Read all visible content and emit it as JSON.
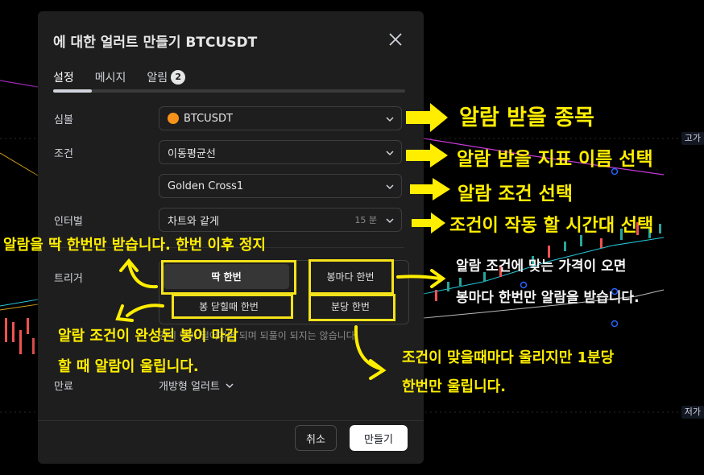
{
  "dialog": {
    "title": "에 대한 얼러트 만들기 BTCUSDT",
    "tabs": [
      {
        "label": "설정"
      },
      {
        "label": "메시지"
      },
      {
        "label": "알림",
        "badge": "2"
      }
    ],
    "symbol": {
      "label": "심볼",
      "value": "BTCUSDT"
    },
    "condition": {
      "label": "조건",
      "indicator": "이동평균선",
      "crossing": "Golden Cross1"
    },
    "interval": {
      "label": "인터벌",
      "value": "차트와 같게",
      "suffix": "15 분"
    },
    "trigger": {
      "label": "트리거",
      "options": [
        "딱 한번",
        "봉마다 한번",
        "봉 닫힐때 한번",
        "분당 한번"
      ],
      "selected": "딱 한번",
      "description": "건이 맞아 떨어지면 되며 되풀이 되지는 않습니다"
    },
    "expiry": {
      "label": "만료",
      "value": "개방형 얼러트"
    },
    "buttons": {
      "cancel": "취소",
      "create": "만들기"
    }
  },
  "price_tags": {
    "high": "고가",
    "low": "저가"
  },
  "annotations": {
    "symbol": "알람 받을 종목",
    "indicator": "알람 받을 지표 이름 선택",
    "condition": "알람 조건 선택",
    "interval": "조건이 작동 할 시간대 선택",
    "once": "알람을 딱 한번만 받습니다. 한번 이후 정지",
    "per_bar_1": "알람 조건에 맞는 가격이 오면",
    "per_bar_2": "봉마다 한번만 알람을 받습니다.",
    "bar_close_1": "알람 조건이 완성된 봉이 마감",
    "bar_close_2": "할 때 알람이 울립니다.",
    "per_minute_1": "조건이 맞을때마다 울리지만 1분당",
    "per_minute_2": "한번만 울립니다."
  },
  "colors": {
    "annotation": "#ffee00",
    "dialog_bg": "#1e1e1e",
    "up_candle": "#26a69a",
    "down_candle": "#ef5350"
  }
}
